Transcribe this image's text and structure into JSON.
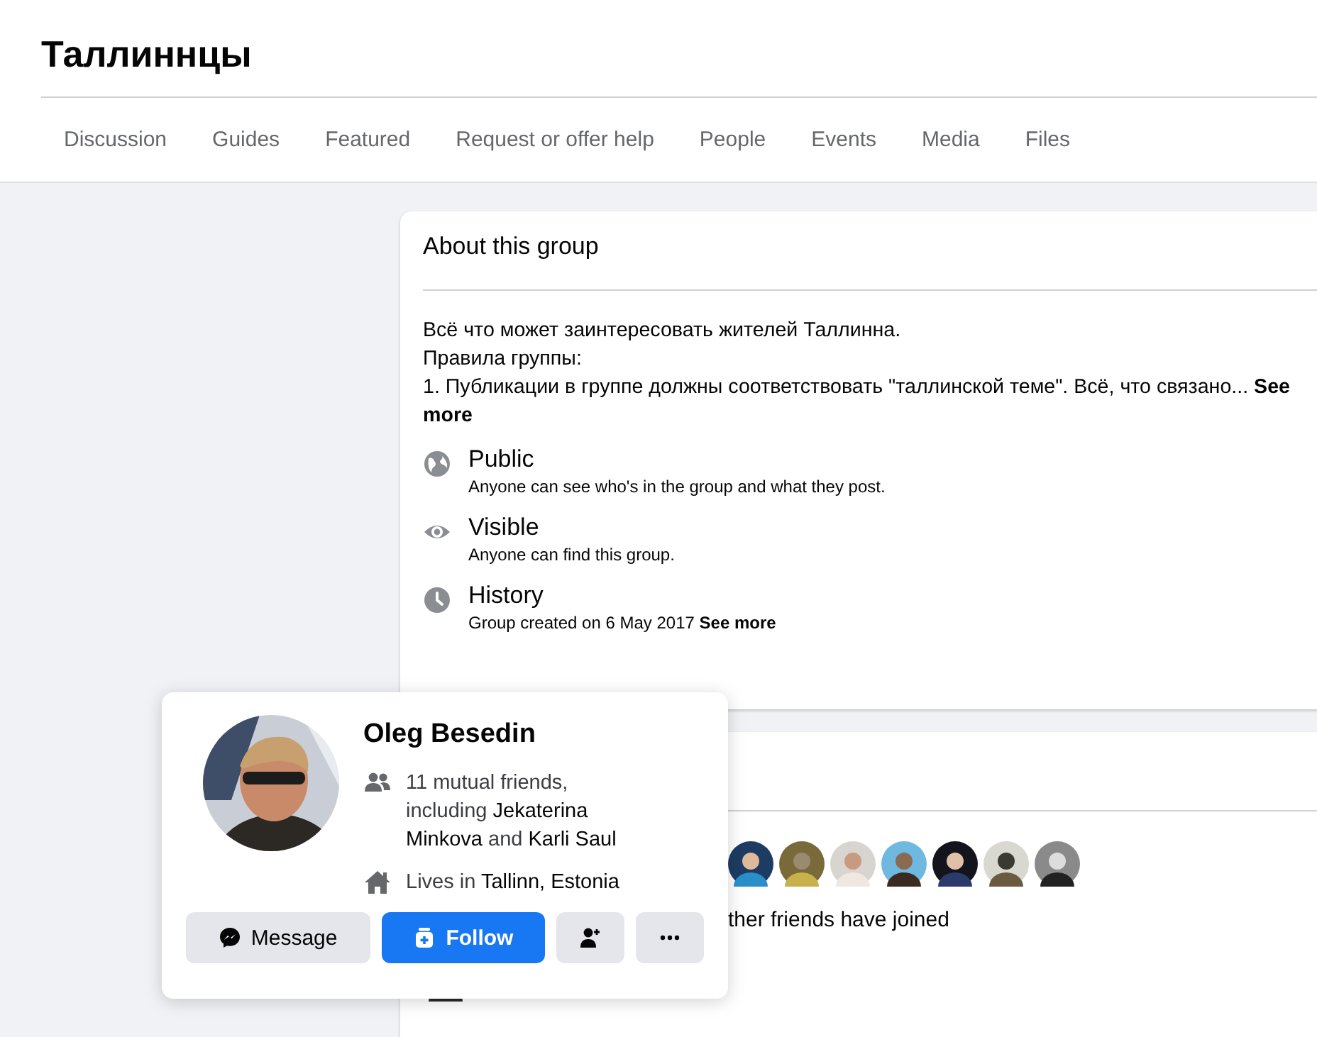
{
  "group": {
    "title": "Таллиннцы"
  },
  "tabs": [
    {
      "label": "Discussion",
      "selected": false
    },
    {
      "label": "Guides",
      "selected": false
    },
    {
      "label": "Featured",
      "selected": false
    },
    {
      "label": "Request or offer help",
      "selected": false
    },
    {
      "label": "People",
      "selected": false
    },
    {
      "label": "Events",
      "selected": false
    },
    {
      "label": "Media",
      "selected": false
    },
    {
      "label": "Files",
      "selected": false
    }
  ],
  "about": {
    "title": "About this group",
    "description": [
      "Всё что может заинтересовать жителей Таллинна.",
      "Правила группы:",
      "1. Публикации в группе должны соответствовать \"таллинской теме\". Всё, что связано... **See more**"
    ],
    "items": [
      {
        "kind": "globe",
        "title": "Public",
        "subtitle": "Anyone can see who's in the group and what they post."
      },
      {
        "kind": "eye",
        "title": "Visible",
        "subtitle": "Anyone can find this group."
      },
      {
        "kind": "clock",
        "title": "History",
        "subtitle": "Group created on 6 May 2017 **See more**"
      }
    ]
  },
  "members": {
    "joined_text": "ther friends have joined"
  },
  "hovercard": {
    "name": "Oleg Besedin",
    "details": [
      {
        "kind": "friends",
        "text": "11 mutual friends, including **Jekaterina Minkova** and **Karli Saul**"
      },
      {
        "kind": "home",
        "text": "Lives in **Tallinn, Estonia**"
      }
    ],
    "buttons": [
      {
        "kind": "message",
        "label": "Message"
      },
      {
        "kind": "follow",
        "label": "Follow"
      },
      {
        "kind": "add-friend"
      },
      {
        "kind": "more"
      }
    ]
  }
}
